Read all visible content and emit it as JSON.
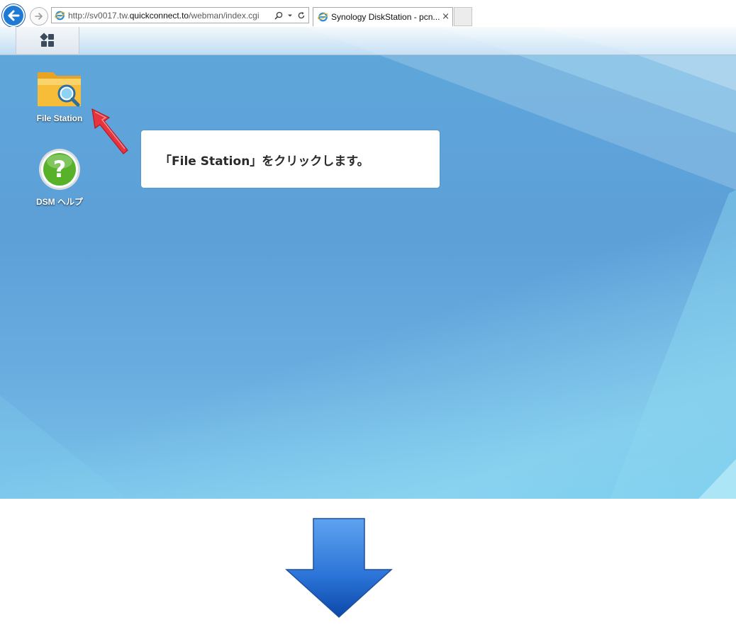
{
  "browser": {
    "url_prefix": "http://sv0017.tw.",
    "url_host": "quickconnect.to",
    "url_path": "/webman/index.cgi",
    "tab_title": "Synology DiskStation - pcn...",
    "tab_close": "×"
  },
  "desktop": {
    "icons": [
      {
        "label": "File Station",
        "icon": "file-station-folder-icon"
      },
      {
        "label": "DSM ヘルプ",
        "icon": "help-question-icon"
      }
    ]
  },
  "callout": {
    "text": "「File Station」をクリックします。"
  },
  "colors": {
    "desktop_blue": "#5ea8db",
    "annotation_red": "#e8323c",
    "down_arrow_blue": "#1f64c8"
  }
}
